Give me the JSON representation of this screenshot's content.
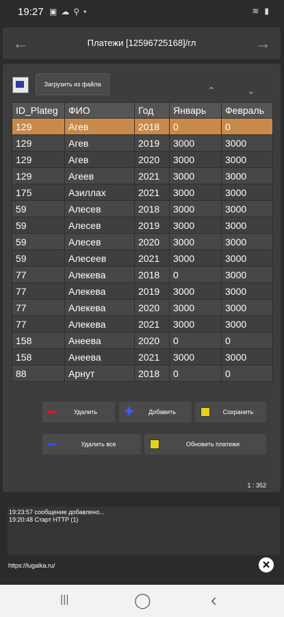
{
  "status": {
    "time": "19:27",
    "left_icons": [
      "▣",
      "☁",
      "⚲",
      "•"
    ],
    "right_icons": [
      "≋",
      "▮"
    ]
  },
  "header": {
    "title": "Платежи [12596725168]/гл",
    "back": "←",
    "forward": "→"
  },
  "toolbar": {
    "load_label": "Загрузить из файла",
    "up": "⌃",
    "down": "⌄"
  },
  "table": {
    "columns": [
      "ID_Plateg",
      "ФИО",
      "Год",
      "Январь",
      "Февраль"
    ],
    "rows": [
      [
        "129",
        "Агев",
        "2018",
        "0",
        "0"
      ],
      [
        "129",
        "Агев",
        "2019",
        "3000",
        "3000"
      ],
      [
        "129",
        "Агев",
        "2020",
        "3000",
        "3000"
      ],
      [
        "129",
        "Агеев",
        "2021",
        "3000",
        "3000"
      ],
      [
        "175",
        "Азиллах",
        "2021",
        "3000",
        "3000"
      ],
      [
        "59",
        "Алесев",
        "2018",
        "3000",
        "3000"
      ],
      [
        "59",
        "Алесев",
        "2019",
        "3000",
        "3000"
      ],
      [
        "59",
        "Алесев",
        "2020",
        "3000",
        "3000"
      ],
      [
        "59",
        "Алесеев",
        "2021",
        "3000",
        "3000"
      ],
      [
        "77",
        "Алекева",
        "2018",
        "0",
        "3000"
      ],
      [
        "77",
        "Алекева",
        "2019",
        "3000",
        "3000"
      ],
      [
        "77",
        "Алекева",
        "2020",
        "3000",
        "3000"
      ],
      [
        "77",
        "Алекева",
        "2021",
        "3000",
        "3000"
      ],
      [
        "158",
        "Анеева",
        "2020",
        "0",
        "0"
      ],
      [
        "158",
        "Анеева",
        "2021",
        "3000",
        "3000"
      ],
      [
        "88",
        "Арнут",
        "2018",
        "0",
        "0"
      ]
    ],
    "selected_row": 0,
    "selected_color": "#c88a4a"
  },
  "buttons": {
    "delete": "Удалить",
    "add": "Добавить",
    "save": "Сохранить",
    "delete_all": "Удалить все",
    "refresh": "Обновить платежи"
  },
  "counter": "1 : 352",
  "log": [
    "19:23:57 сообщение добавлено...",
    "19:20:48 Старт HTTP (1)"
  ],
  "footer": {
    "url": "https://lugalka.ru/",
    "close": "✕"
  },
  "navbar": {
    "recent": "|||",
    "home": "◯",
    "back": "‹"
  }
}
